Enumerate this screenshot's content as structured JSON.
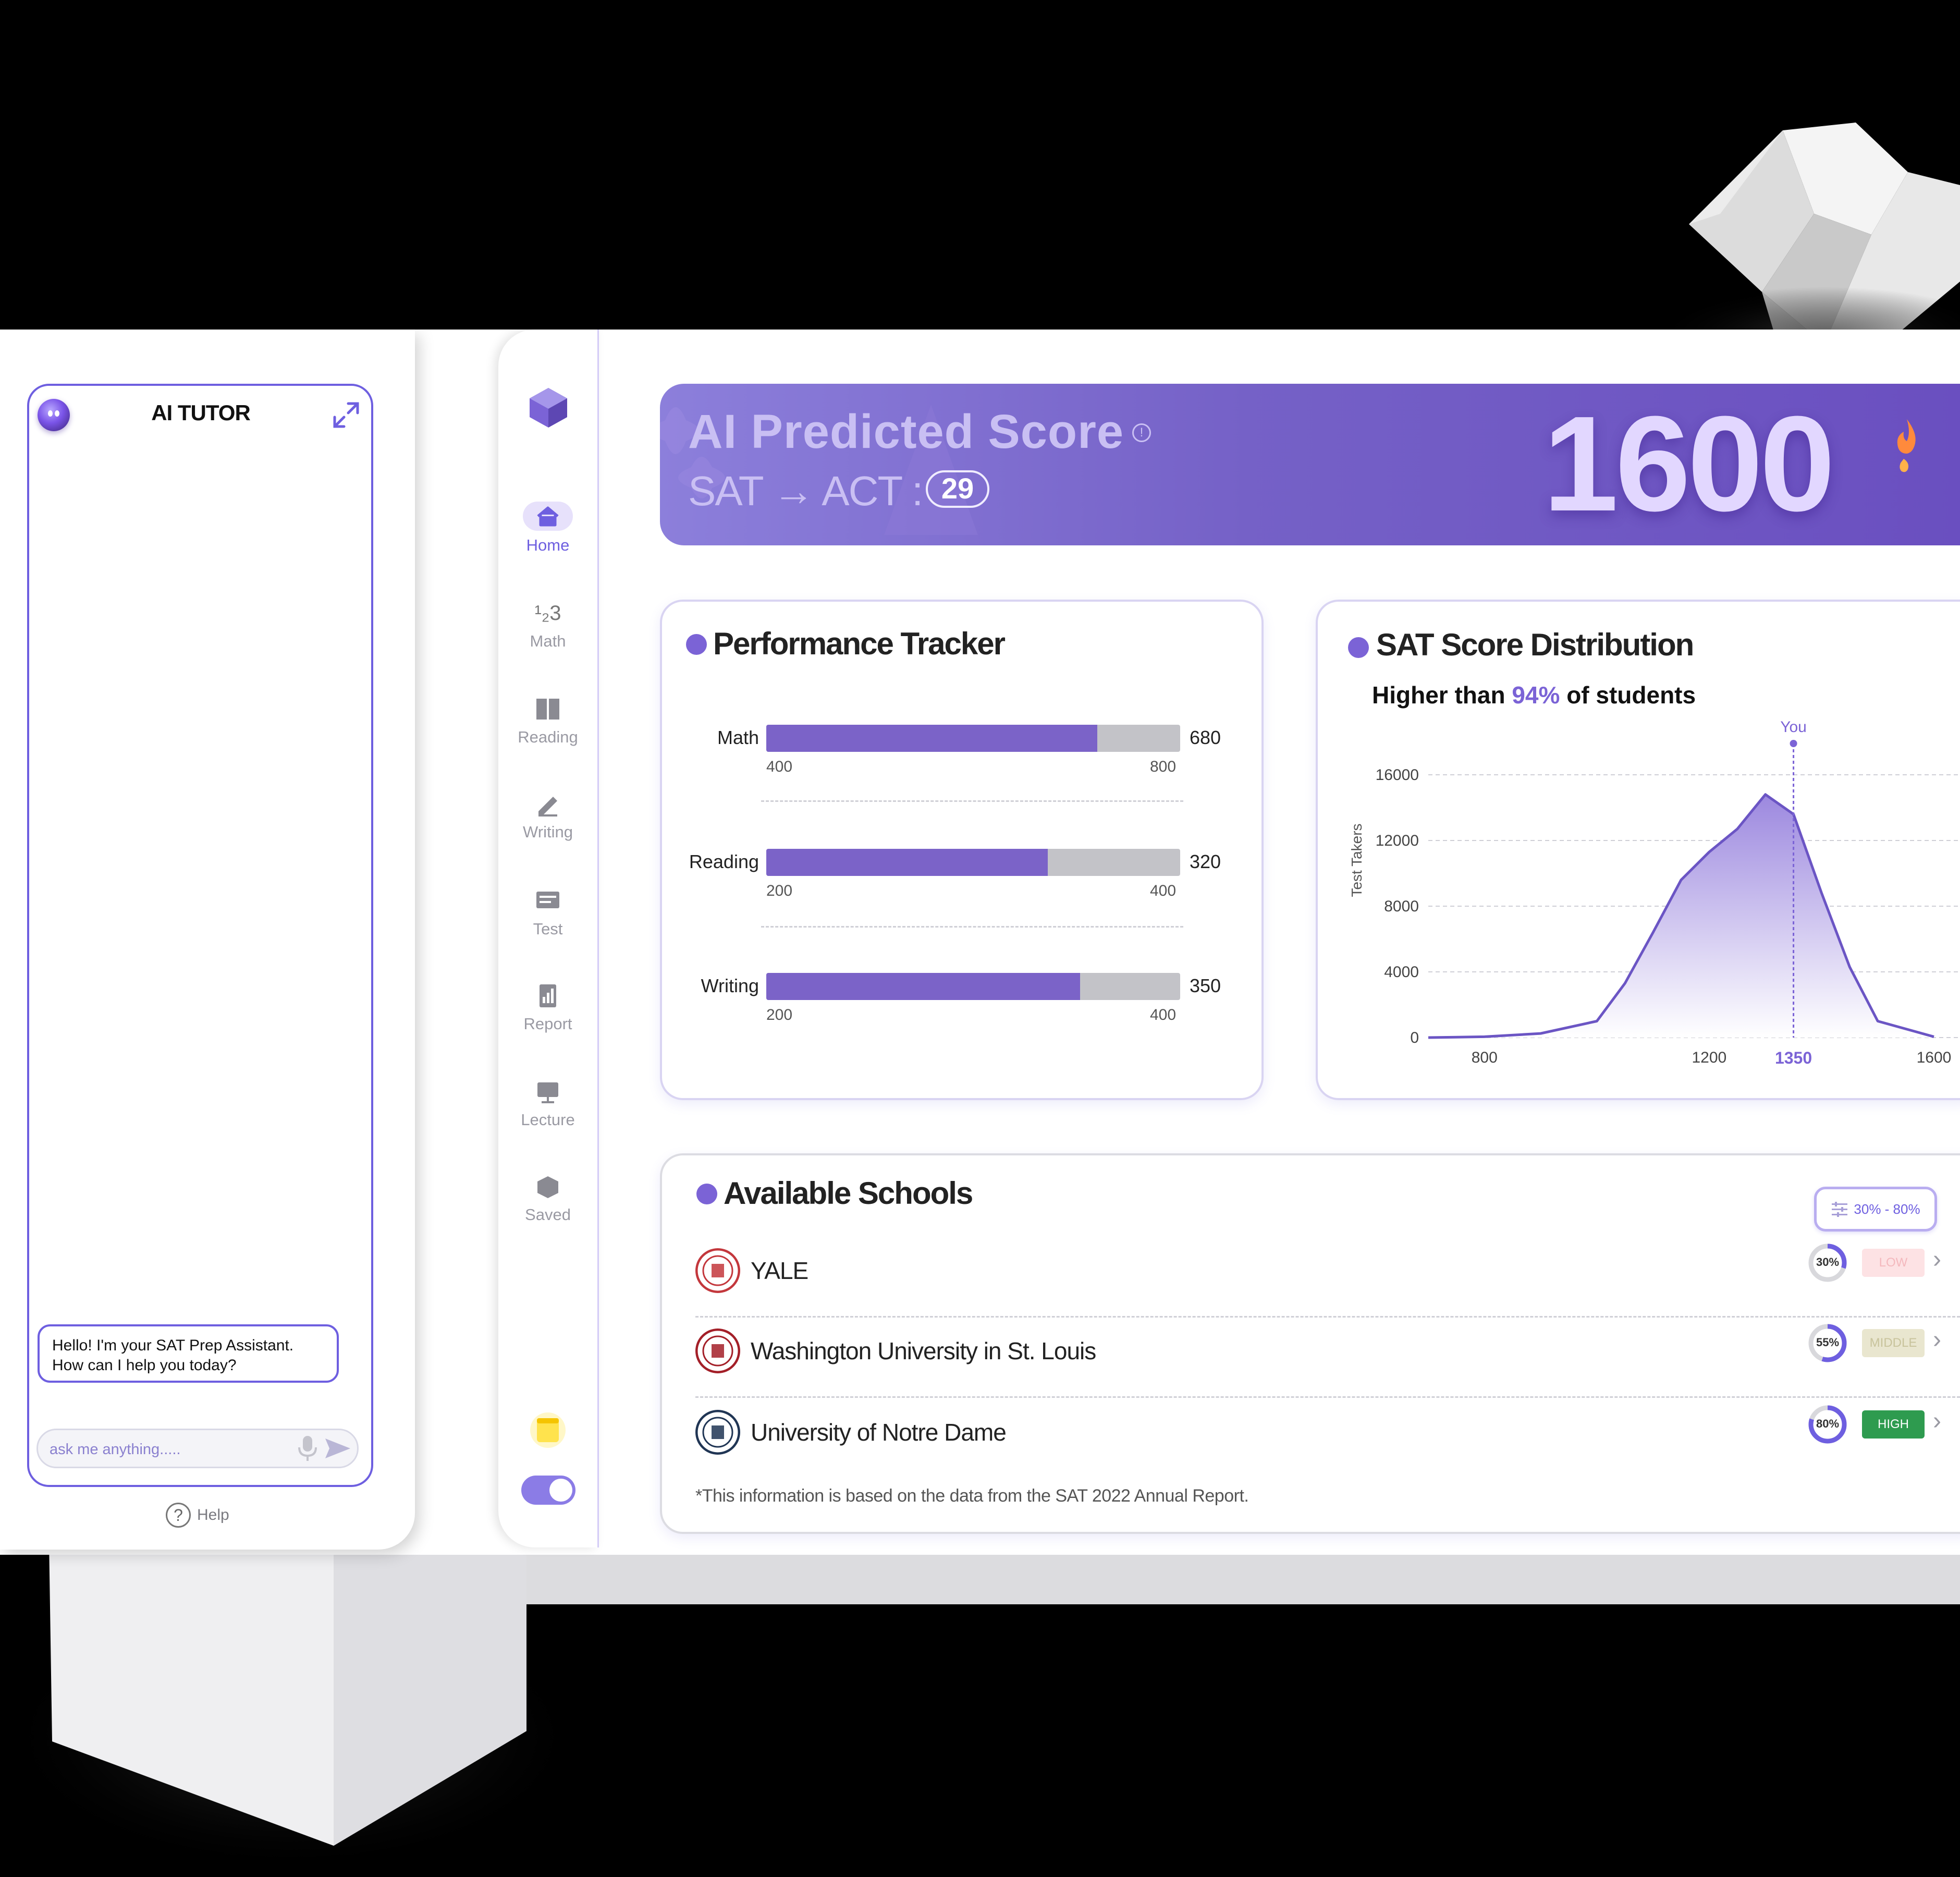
{
  "tutor": {
    "title": "AI TUTOR",
    "greeting_line1": "Hello! I'm your SAT Prep Assistant.",
    "greeting_line2": "How can I help you today?",
    "input_placeholder": "ask me anything.....",
    "help_label": "Help",
    "help_glyph": "?"
  },
  "nav": {
    "items": [
      {
        "label": "Home",
        "icon": "home-icon",
        "active": true
      },
      {
        "label": "Math",
        "icon": "math-icon"
      },
      {
        "label": "Reading",
        "icon": "book-icon"
      },
      {
        "label": "Writing",
        "icon": "pencil-icon"
      },
      {
        "label": "Test",
        "icon": "test-icon"
      },
      {
        "label": "Report",
        "icon": "report-icon"
      },
      {
        "label": "Lecture",
        "icon": "lecture-icon"
      },
      {
        "label": "Saved",
        "icon": "saved-icon"
      }
    ],
    "math_glyph": "¹₂3"
  },
  "hero": {
    "title": "AI Predicted Score",
    "info_glyph": "!",
    "conversion": "SAT → ACT :",
    "act_score": "29",
    "score": "1600"
  },
  "performance": {
    "title": "Performance Tracker",
    "rows": [
      {
        "label": "Math",
        "value": "680",
        "min": "400",
        "max": "800",
        "fill": 0.8
      },
      {
        "label": "Reading",
        "value": "320",
        "min": "200",
        "max": "400",
        "fill": 0.68
      },
      {
        "label": "Writing",
        "value": "350",
        "min": "200",
        "max": "400",
        "fill": 0.758
      }
    ]
  },
  "distribution": {
    "title": "SAT Score Distribution",
    "sub_prefix": "Higher than ",
    "sub_pct": "94%",
    "sub_suffix": " of students"
  },
  "chart_data": {
    "type": "area",
    "ylabel": "Test Takers",
    "x": [
      700,
      800,
      900,
      1000,
      1050,
      1100,
      1150,
      1200,
      1250,
      1300,
      1350,
      1400,
      1450,
      1500,
      1600
    ],
    "y": [
      0,
      50,
      250,
      1000,
      3300,
      6400,
      9600,
      11300,
      12700,
      14800,
      13600,
      8800,
      4300,
      1000,
      50
    ],
    "xlim": [
      700,
      1600
    ],
    "ylim": [
      0,
      16000
    ],
    "xticks": [
      "800",
      "1200",
      "1600"
    ],
    "yticks": [
      "0",
      "4000",
      "8000",
      "12000",
      "16000"
    ],
    "marker": {
      "x": 1350,
      "label": "You",
      "tick": "1350"
    },
    "colors": {
      "line": "#6b55c4",
      "fill_top": "#9c88df",
      "fill_bottom": "#ffffff",
      "marker": "#7b63d6"
    }
  },
  "schools": {
    "title": "Available Schools",
    "filter_label": "30% - 80%",
    "rows": [
      {
        "name": "YALE",
        "pct": "30%",
        "pct_value": 0.3,
        "chance": "LOW",
        "chance_bg": "#fde2e4",
        "chance_fg": "#f4b8bd",
        "seal": "#c3373c"
      },
      {
        "name": "Washington University in St. Louis",
        "pct": "55%",
        "pct_value": 0.55,
        "chance": "MIDDLE",
        "chance_bg": "#e9e6cf",
        "chance_fg": "#c8c39b",
        "seal": "#a31f28"
      },
      {
        "name": "University of Notre Dame",
        "pct": "80%",
        "pct_value": 0.8,
        "chance": "HIGH",
        "chance_bg": "#2e9b4f",
        "chance_fg": "#ffffff",
        "seal": "#203554"
      }
    ],
    "footnote": "*This information is based on the data from the SAT 2022 Annual Report."
  },
  "colors": {
    "accent": "#7b63d6",
    "frame": "#6e5fe0"
  }
}
